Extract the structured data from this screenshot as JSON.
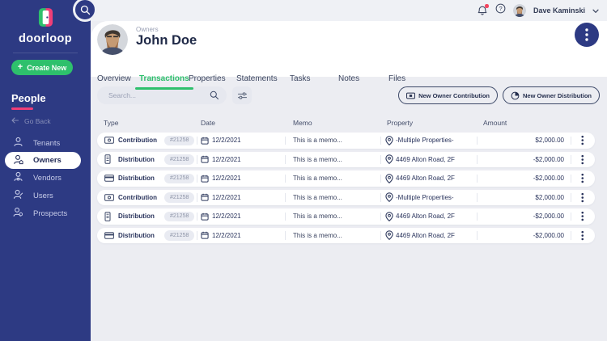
{
  "colors": {
    "sidebar_bg": "#2d3a83",
    "accent_green": "#2ec06c",
    "accent_pink": "#f03e77",
    "navy_text": "#29335c",
    "notification_red": "#f3455f",
    "panel_white": "#ffffff",
    "content_bg": "#ecedf2"
  },
  "sidebar": {
    "logo_text": "doorloop",
    "create_button_label": "Create New",
    "section_title": "People",
    "back_label": "Go Back",
    "items": [
      {
        "label": "Tenants",
        "active": false
      },
      {
        "label": "Owners",
        "active": true
      },
      {
        "label": "Vendors",
        "active": false
      },
      {
        "label": "Users",
        "active": false
      },
      {
        "label": "Prospects",
        "active": false
      }
    ]
  },
  "topbar": {
    "user_name": "Dave Kaminski",
    "has_notification": true
  },
  "header": {
    "eyebrow": "Owners",
    "title": "John Doe"
  },
  "tabs": [
    {
      "label": "Overview",
      "active": false
    },
    {
      "label": "Transactions",
      "active": true
    },
    {
      "label": "Properties",
      "active": false
    },
    {
      "label": "Statements",
      "active": false
    },
    {
      "label": "Tasks",
      "active": false
    },
    {
      "label": "Notes",
      "active": false
    },
    {
      "label": "Files",
      "active": false
    }
  ],
  "toolbar": {
    "search_placeholder": "Search...",
    "new_contribution_label": "New Owner Contribution",
    "new_distribution_label": "New Owner Distribution"
  },
  "table": {
    "columns": [
      "Type",
      "Date",
      "Memo",
      "Property",
      "Amount"
    ],
    "rows": [
      {
        "type": "Contribution",
        "icon": "cash-icon",
        "ref": "#21258",
        "date": "12/2/2021",
        "memo": "This is a memo...",
        "property": "-Multiple Properties-",
        "amount": "$2,000.00"
      },
      {
        "type": "Distribution",
        "icon": "receipt-icon",
        "ref": "#21258",
        "date": "12/2/2021",
        "memo": "This is a memo...",
        "property": "4469 Alton Road, 2F",
        "amount": "-$2,000.00"
      },
      {
        "type": "Distribution",
        "icon": "credit-card-icon",
        "ref": "#21258",
        "date": "12/2/2021",
        "memo": "This is a memo...",
        "property": "4469 Alton Road, 2F",
        "amount": "-$2,000.00"
      },
      {
        "type": "Contribution",
        "icon": "cash-icon",
        "ref": "#21258",
        "date": "12/2/2021",
        "memo": "This is a memo...",
        "property": "-Multiple Properties-",
        "amount": "$2,000.00"
      },
      {
        "type": "Distribution",
        "icon": "receipt-icon",
        "ref": "#21258",
        "date": "12/2/2021",
        "memo": "This is a memo...",
        "property": "4469 Alton Road, 2F",
        "amount": "-$2,000.00"
      },
      {
        "type": "Distribution",
        "icon": "credit-card-icon",
        "ref": "#21258",
        "date": "12/2/2021",
        "memo": "This is a memo...",
        "property": "4469 Alton Road, 2F",
        "amount": "-$2,000.00"
      }
    ]
  },
  "icons": {
    "search-icon": "magnifier",
    "bell-icon": "bell with red dot",
    "help-icon": "question mark in circle",
    "chevron-down-icon": "v chevron",
    "door-logo-icon": "green/pink door",
    "back-arrow-icon": "left arrow",
    "person-icon": "person silhouette",
    "filter-icon": "slider lines",
    "calendar-icon": "calendar",
    "location-pin-icon": "map pin",
    "kebab-menu-icon": "3 vertical dots",
    "cash-icon": "banknote",
    "receipt-icon": "receipt",
    "credit-card-icon": "credit card",
    "deposit-icon": "banknote in box",
    "pie-icon": "pie chart"
  }
}
